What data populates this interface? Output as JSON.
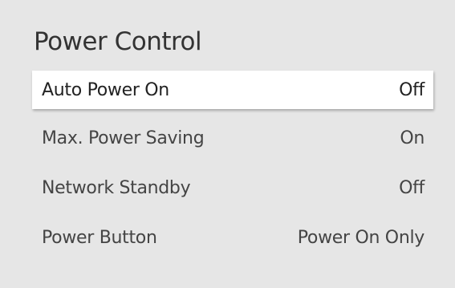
{
  "menu": {
    "title": "Power Control",
    "items": [
      {
        "label": "Auto Power On",
        "value": "Off"
      },
      {
        "label": "Max. Power Saving",
        "value": "On"
      },
      {
        "label": "Network Standby",
        "value": "Off"
      },
      {
        "label": "Power Button",
        "value": "Power On Only"
      }
    ]
  },
  "colors": {
    "panel_background": "#e6e6e6",
    "selected_background": "#ffffff",
    "text": "#444444"
  }
}
